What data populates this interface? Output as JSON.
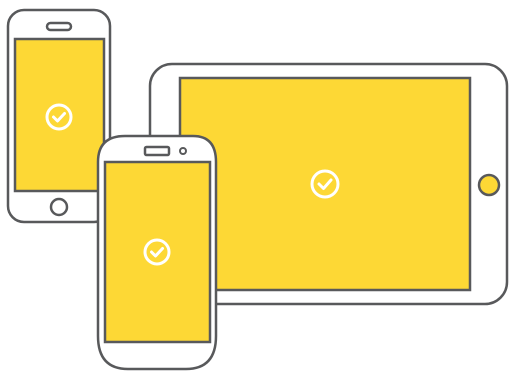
{
  "colors": {
    "screen": "#FDD835",
    "outline": "#58595B",
    "check": "#FFFFFF",
    "background": "#FFFFFF"
  },
  "devices": [
    {
      "type": "iphone",
      "status_icon": "check-circle-icon",
      "home_button": "round-outline"
    },
    {
      "type": "android-phone",
      "status_icon": "check-circle-icon"
    },
    {
      "type": "tablet",
      "status_icon": "check-circle-icon",
      "home_button": "round-yellow"
    }
  ]
}
